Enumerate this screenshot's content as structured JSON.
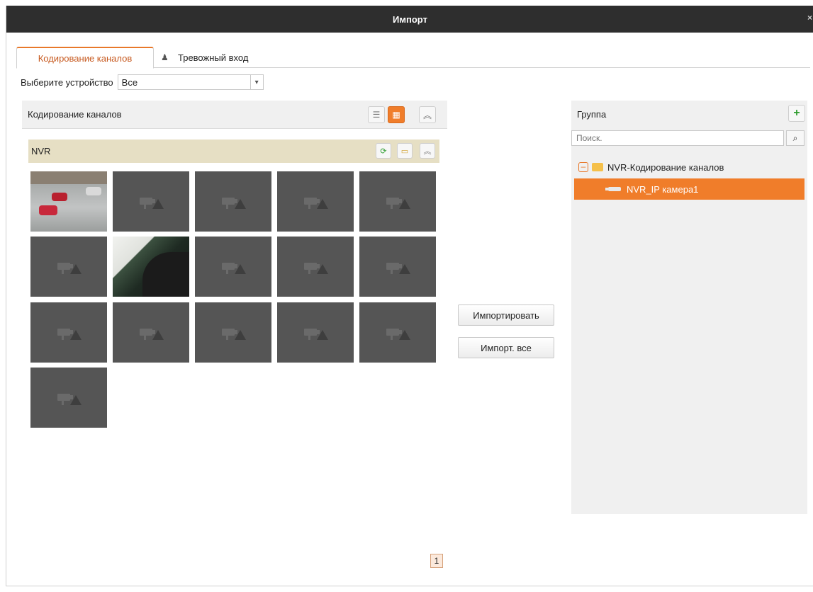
{
  "window": {
    "title": "Импорт",
    "close_glyph": "×"
  },
  "tabs": [
    {
      "label": "Кодирование каналов",
      "active": true
    },
    {
      "label": "Тревожный вход",
      "active": false,
      "icon": "alarm-input-icon"
    }
  ],
  "device": {
    "label": "Выберите устройство",
    "selected": "Все"
  },
  "left_panel": {
    "title": "Кодирование каналов",
    "group": {
      "name": "NVR"
    },
    "channels_total": 16,
    "pager": {
      "current_page": "1"
    }
  },
  "actions": {
    "import_label": "Импортировать",
    "import_all_label": "Импорт. все"
  },
  "right_panel": {
    "title": "Группа",
    "search_placeholder": "Поиск.",
    "tree": {
      "root_label": "NVR-Кодирование каналов",
      "child_label": "NVR_IP камера1"
    }
  },
  "colors": {
    "accent": "#f07d2a",
    "title_bar": "#2e2e2e",
    "nvr_bar": "#e6dfc4"
  }
}
